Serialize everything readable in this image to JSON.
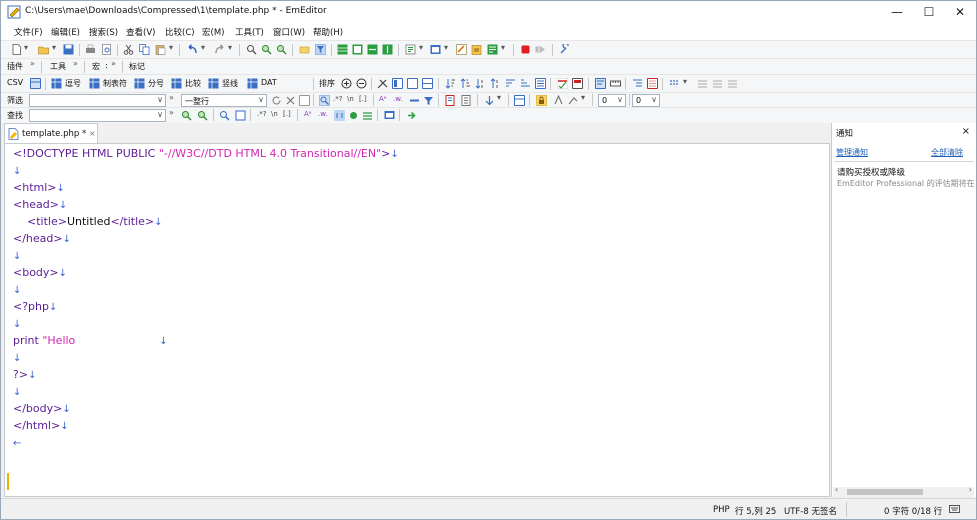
{
  "window": {
    "title": "C:\\Users\\mae\\Downloads\\Compressed\\1\\template.php * - EmEditor",
    "minimize": "—",
    "maximize": "☐",
    "close": "✕"
  },
  "menu": [
    "文件(F)",
    "编辑(E)",
    "搜索(S)",
    "查看(V)",
    "比较(C)",
    "宏(M)",
    "工具(T)",
    "窗口(W)",
    "帮助(H)"
  ],
  "toolbar2": {
    "plugins": "插件",
    "tools": "工具",
    "macro": "宏",
    "macro_state": ":",
    "marks": "标记"
  },
  "csv_bar": {
    "csv": "CSV",
    "items": [
      "逗号",
      "制表符",
      "分号",
      "比较",
      "竖线",
      "DAT"
    ],
    "sort": "排序"
  },
  "filter_bar": {
    "label": "筛选",
    "value": "",
    "mode": "一整行",
    "num1": "0",
    "num2": "0"
  },
  "find_bar": {
    "label": "查找",
    "value": ""
  },
  "tab": {
    "label": "template.php *",
    "close": "×"
  },
  "code": [
    {
      "parts": [
        {
          "c": "tag",
          "t": "<!DOCTYPE HTML PUBLIC "
        },
        {
          "c": "str",
          "t": "\"-//W3C//DTD HTML 4.0 Transitional//EN\""
        },
        {
          "c": "tag",
          "t": ">"
        }
      ],
      "eol": "↓"
    },
    {
      "parts": [],
      "eol": "↓"
    },
    {
      "parts": [
        {
          "c": "tag",
          "t": "<html>"
        }
      ],
      "eol": "↓"
    },
    {
      "parts": [
        {
          "c": "tag",
          "t": "<head>"
        }
      ],
      "eol": "↓"
    },
    {
      "parts": [
        {
          "c": "txt",
          "t": "    "
        },
        {
          "c": "tag",
          "t": "<title>"
        },
        {
          "c": "txt",
          "t": "Untitled"
        },
        {
          "c": "tag",
          "t": "</title>"
        }
      ],
      "eol": "↓"
    },
    {
      "parts": [
        {
          "c": "tag",
          "t": "</head>"
        }
      ],
      "eol": "↓"
    },
    {
      "parts": [],
      "eol": "↓"
    },
    {
      "parts": [
        {
          "c": "tag",
          "t": "<body>"
        }
      ],
      "eol": "↓"
    },
    {
      "parts": [],
      "eol": "↓"
    },
    {
      "parts": [
        {
          "c": "tag",
          "t": "<?php"
        }
      ],
      "eol": "↓"
    },
    {
      "parts": [],
      "eol": "↓"
    },
    {
      "parts": [
        {
          "c": "tag",
          "t": "print "
        },
        {
          "c": "str",
          "t": "\"Hello                        "
        }
      ],
      "eol": "↓"
    },
    {
      "parts": [],
      "eol": "↓"
    },
    {
      "parts": [
        {
          "c": "tag",
          "t": "?>"
        }
      ],
      "eol": "↓"
    },
    {
      "parts": [],
      "eol": "↓"
    },
    {
      "parts": [
        {
          "c": "tag",
          "t": "</body>"
        }
      ],
      "eol": "↓"
    },
    {
      "parts": [
        {
          "c": "tag",
          "t": "</html>"
        }
      ],
      "eol": "↓"
    },
    {
      "parts": [],
      "eol": "←"
    }
  ],
  "panel": {
    "title": "通知",
    "close": "×",
    "manage": "管理通知",
    "clear_all": "全部清除",
    "notice_title": "请购买授权或降级",
    "notice_body": "EmEditor Professional 的评估期将在"
  },
  "status": {
    "lang": "PHP",
    "position": "行 5,列 25",
    "encoding": "UTF-8 无签名",
    "count": "0 字符 0/18 行"
  },
  "colors": {
    "tag": "#5b1d95",
    "string": "#d426b3",
    "eol": "#3b63d4",
    "link": "#1d5fb5"
  }
}
